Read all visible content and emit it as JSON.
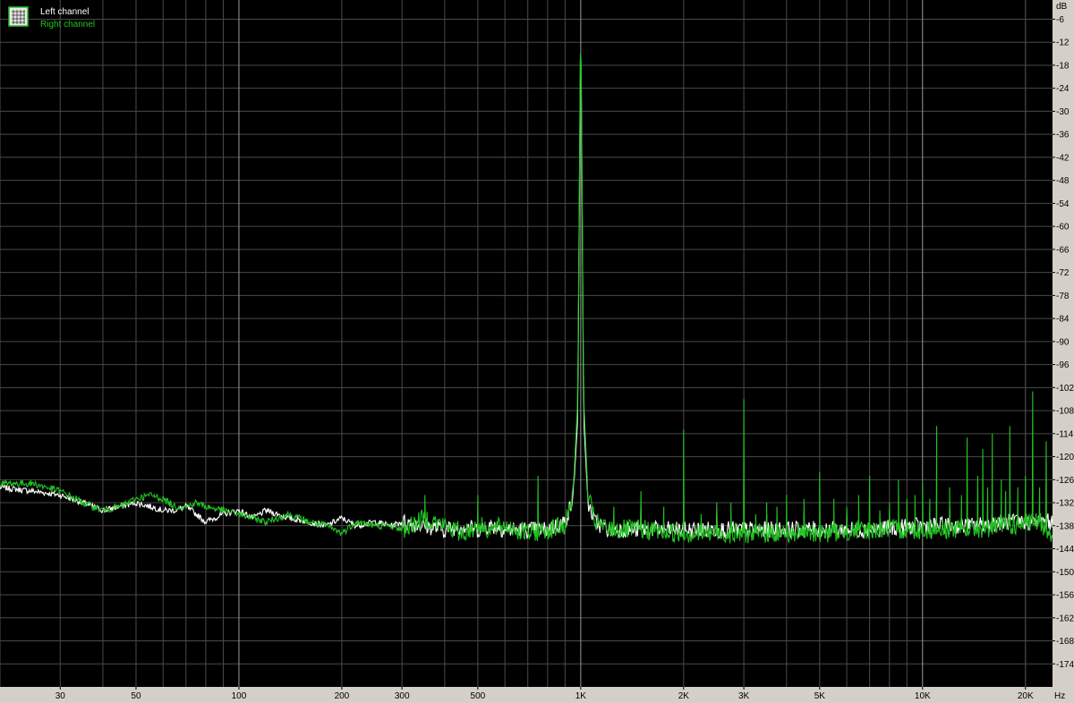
{
  "colors": {
    "plot_background": "#000000",
    "frame_background": "#d4d0c8",
    "grid_major": "#9a9a9a",
    "grid_minor": "#4a4a4a",
    "left_channel": "#ffffff",
    "right_channel": "#22c422"
  },
  "legend": {
    "icon": "grid-icon",
    "placement": "top-left"
  },
  "chart_data": {
    "type": "line",
    "title": "",
    "xlabel": "",
    "ylabel": "",
    "x_unit": "Hz",
    "y_unit": "dB",
    "x_scale": "log",
    "xlim": [
      20,
      24000
    ],
    "ylim": [
      -180,
      -1
    ],
    "grid": true,
    "x_ticks": [
      {
        "value": 30,
        "label": "30"
      },
      {
        "value": 50,
        "label": "50"
      },
      {
        "value": 100,
        "label": "100"
      },
      {
        "value": 200,
        "label": "200"
      },
      {
        "value": 300,
        "label": "300"
      },
      {
        "value": 500,
        "label": "500"
      },
      {
        "value": 1000,
        "label": "1K"
      },
      {
        "value": 2000,
        "label": "2K"
      },
      {
        "value": 3000,
        "label": "3K"
      },
      {
        "value": 5000,
        "label": "5K"
      },
      {
        "value": 10000,
        "label": "10K"
      },
      {
        "value": 20000,
        "label": "20K"
      }
    ],
    "y_ticks": [
      -6,
      -12,
      -18,
      -24,
      -30,
      -36,
      -42,
      -48,
      -54,
      -60,
      -66,
      -72,
      -78,
      -84,
      -90,
      -96,
      -102,
      -108,
      -114,
      -120,
      -126,
      -132,
      -138,
      -144,
      -150,
      -156,
      -162,
      -168,
      -174
    ],
    "series": [
      {
        "name": "Left channel",
        "color": "#ffffff",
        "x": [
          20,
          25,
          30,
          35,
          40,
          45,
          50,
          55,
          60,
          65,
          70,
          75,
          80,
          90,
          100,
          110,
          120,
          140,
          160,
          180,
          200,
          220,
          250,
          280,
          300,
          350,
          400,
          450,
          500,
          550,
          600,
          700,
          800,
          900,
          950,
          980,
          1000,
          1020,
          1050,
          1100,
          1200,
          1500,
          2000,
          3000,
          5000,
          7000,
          10000,
          14000,
          18000,
          22000,
          24000
        ],
        "y": [
          -128,
          -129,
          -130,
          -132,
          -134,
          -133,
          -132,
          -133,
          -134,
          -134,
          -133,
          -135,
          -137,
          -135,
          -134,
          -136,
          -134,
          -136,
          -137,
          -138,
          -136,
          -138,
          -137,
          -138,
          -137,
          -138,
          -139,
          -138,
          -139,
          -138,
          -139,
          -139,
          -139,
          -137,
          -131,
          -110,
          -4,
          -110,
          -132,
          -137,
          -139,
          -139,
          -139,
          -139,
          -139,
          -139,
          -138,
          -138,
          -137,
          -137,
          -137
        ]
      },
      {
        "name": "Right channel",
        "color": "#22c422",
        "x": [
          20,
          25,
          30,
          35,
          40,
          45,
          50,
          55,
          60,
          65,
          70,
          75,
          80,
          90,
          100,
          110,
          120,
          140,
          160,
          180,
          200,
          220,
          250,
          280,
          300,
          350,
          400,
          450,
          500,
          550,
          600,
          700,
          800,
          900,
          950,
          980,
          1000,
          1020,
          1050,
          1100,
          1200,
          1500,
          2000,
          3000,
          5000,
          7000,
          10000,
          14000,
          18000,
          22000,
          24000
        ],
        "y": [
          -127,
          -127,
          -129,
          -132,
          -134,
          -133,
          -131,
          -130,
          -131,
          -133,
          -133,
          -132,
          -133,
          -134,
          -135,
          -136,
          -137,
          -135,
          -137,
          -138,
          -140,
          -137,
          -138,
          -138,
          -139,
          -136,
          -138,
          -140,
          -138,
          -139,
          -138,
          -140,
          -139,
          -138,
          -130,
          -105,
          -3,
          -105,
          -130,
          -137,
          -139,
          -139,
          -140,
          -140,
          -140,
          -139,
          -139,
          -139,
          -138,
          -137,
          -140
        ]
      }
    ],
    "spurs_right": [
      {
        "x": 350,
        "y": -130
      },
      {
        "x": 500,
        "y": -130
      },
      {
        "x": 750,
        "y": -125
      },
      {
        "x": 1250,
        "y": -133
      },
      {
        "x": 1500,
        "y": -129
      },
      {
        "x": 1750,
        "y": -133
      },
      {
        "x": 2000,
        "y": -113
      },
      {
        "x": 2250,
        "y": -135
      },
      {
        "x": 2500,
        "y": -132
      },
      {
        "x": 2750,
        "y": -132
      },
      {
        "x": 3000,
        "y": -105
      },
      {
        "x": 3250,
        "y": -135
      },
      {
        "x": 3500,
        "y": -132
      },
      {
        "x": 3750,
        "y": -133
      },
      {
        "x": 4000,
        "y": -130
      },
      {
        "x": 4500,
        "y": -131
      },
      {
        "x": 5000,
        "y": -124
      },
      {
        "x": 5500,
        "y": -131
      },
      {
        "x": 6000,
        "y": -133
      },
      {
        "x": 6500,
        "y": -130
      },
      {
        "x": 7000,
        "y": -125
      },
      {
        "x": 7500,
        "y": -134
      },
      {
        "x": 8000,
        "y": -132
      },
      {
        "x": 8500,
        "y": -126
      },
      {
        "x": 9000,
        "y": -131
      },
      {
        "x": 9500,
        "y": -130
      },
      {
        "x": 10000,
        "y": -127
      },
      {
        "x": 10500,
        "y": -131
      },
      {
        "x": 11000,
        "y": -112
      },
      {
        "x": 12000,
        "y": -128
      },
      {
        "x": 13000,
        "y": -130
      },
      {
        "x": 13500,
        "y": -115
      },
      {
        "x": 14500,
        "y": -125
      },
      {
        "x": 15000,
        "y": -118
      },
      {
        "x": 15500,
        "y": -128
      },
      {
        "x": 16000,
        "y": -114
      },
      {
        "x": 17000,
        "y": -126
      },
      {
        "x": 17500,
        "y": -129
      },
      {
        "x": 18000,
        "y": -112
      },
      {
        "x": 19000,
        "y": -128
      },
      {
        "x": 20000,
        "y": -125
      },
      {
        "x": 21000,
        "y": -103
      },
      {
        "x": 22000,
        "y": -128
      },
      {
        "x": 23000,
        "y": -116
      }
    ],
    "spurs_left": [
      {
        "x": 1500,
        "y": -133
      },
      {
        "x": 2500,
        "y": -134
      },
      {
        "x": 3500,
        "y": -135
      },
      {
        "x": 4500,
        "y": -135
      },
      {
        "x": 6000,
        "y": -134
      },
      {
        "x": 8000,
        "y": -134
      },
      {
        "x": 12000,
        "y": -133
      },
      {
        "x": 16000,
        "y": -132
      },
      {
        "x": 20000,
        "y": -132
      }
    ]
  }
}
